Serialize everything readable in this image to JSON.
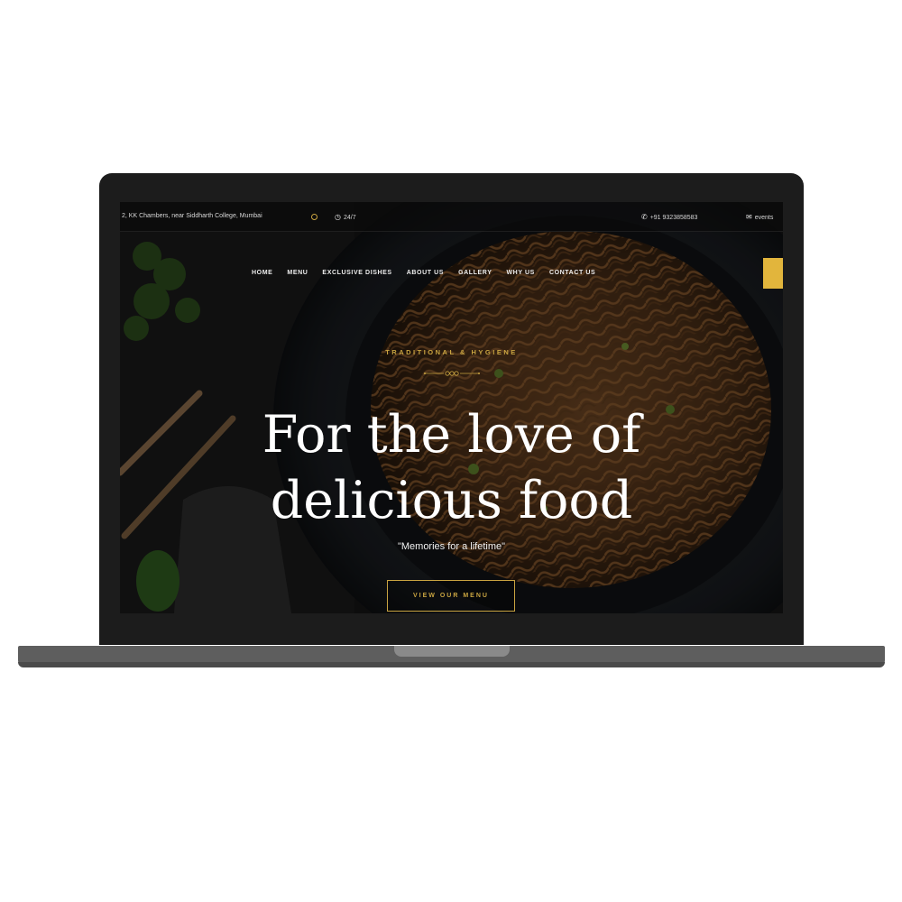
{
  "topbar": {
    "address": "2, KK Chambers, near Siddharth College, Mumbai",
    "hours_icon": "clock-icon",
    "hours": "24/7",
    "phone_icon": "phone-icon",
    "phone": "+91 9323858583",
    "email_icon": "mail-icon",
    "email": "events"
  },
  "nav": {
    "items": [
      {
        "label": "HOME"
      },
      {
        "label": "MENU"
      },
      {
        "label": "EXCLUSIVE DISHES"
      },
      {
        "label": "ABOUT US"
      },
      {
        "label": "GALLERY"
      },
      {
        "label": "WHY US"
      },
      {
        "label": "CONTACT US"
      }
    ]
  },
  "hero": {
    "tagline": "TRADITIONAL & HYGIENE",
    "headline_line1": "For the love of",
    "headline_line2": "delicious food",
    "subtitle": "\"Memories for a lifetime\"",
    "cta_label": "VIEW OUR MENU"
  },
  "colors": {
    "accent": "#c9a441",
    "side_tab": "#e2b53c",
    "background": "#121212"
  }
}
